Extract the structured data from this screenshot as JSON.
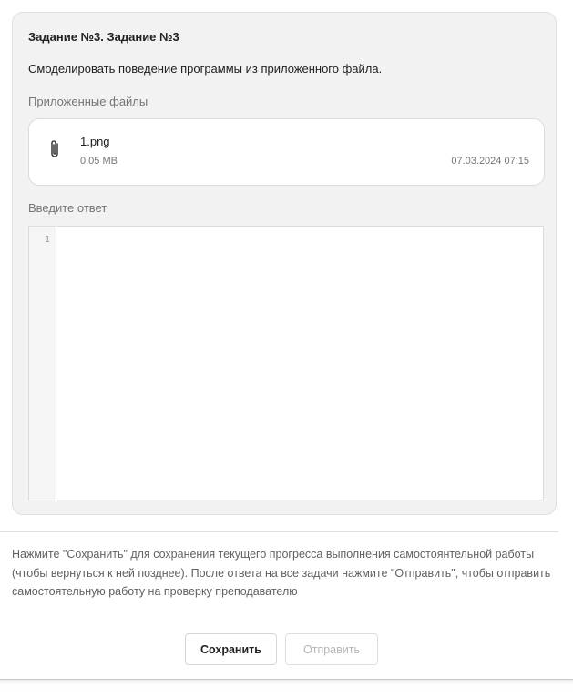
{
  "task": {
    "title": "Задание №3. Задание №3",
    "description": "Смоделировать поведение программы из приложенного файла.",
    "attached_files_label": "Приложенные файлы",
    "files": [
      {
        "icon": "paperclip-icon",
        "name": "1.png",
        "size": "0.05 MB",
        "date": "07.03.2024 07:15"
      }
    ],
    "answer_label": "Введите ответ",
    "editor": {
      "line_numbers": [
        "1"
      ],
      "value": ""
    }
  },
  "footer": {
    "hint": "Нажмите \"Сохранить\" для сохранения текущего прогресса выполнения самостоянтельной работы (чтобы вернуться к ней позднее). После ответа на все задачи нажмите \"Отправить\", чтобы отправить самостоятельную работу на проверку преподавателю",
    "save_label": "Сохранить",
    "submit_label": "Отправить"
  },
  "colors": {
    "card_background": "#f2f2f2",
    "disabled_text": "#b5b5b5"
  }
}
